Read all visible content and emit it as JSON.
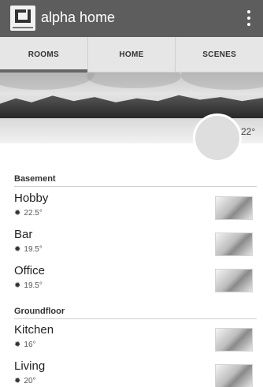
{
  "app": {
    "title": "alpha home",
    "logo_icon": "alpha-home-logo",
    "overflow_icon": "more-vert-icon"
  },
  "tabs": [
    {
      "label": "ROOMS",
      "active": true
    },
    {
      "label": "HOME",
      "active": false
    },
    {
      "label": "SCENES",
      "active": false
    }
  ],
  "hero": {
    "temperature": "22°"
  },
  "sections": [
    {
      "title": "Basement",
      "rooms": [
        {
          "name": "Hobby",
          "temp": "22.5°",
          "icon": "sun-icon"
        },
        {
          "name": "Bar",
          "temp": "19.5°",
          "icon": "sun-icon"
        },
        {
          "name": "Office",
          "temp": "19.5°",
          "icon": "sun-icon"
        }
      ]
    },
    {
      "title": "Groundfloor",
      "rooms": [
        {
          "name": "Kitchen",
          "temp": "16°",
          "icon": "sun-icon"
        },
        {
          "name": "Living",
          "temp": "20°",
          "icon": "sun-icon"
        }
      ]
    }
  ],
  "colors": {
    "appbar": "#5d5d5d",
    "tabbar": "#e6e6e6",
    "active_tab_indicator": "#666666"
  }
}
